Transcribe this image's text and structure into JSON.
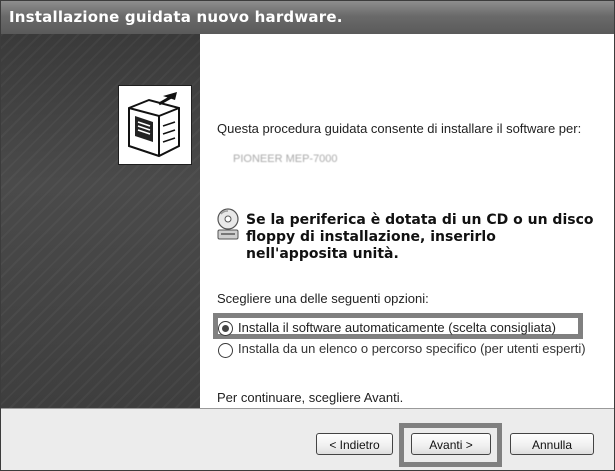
{
  "window": {
    "title": "Installazione guidata nuovo hardware."
  },
  "content": {
    "intro": "Questa procedura guidata consente di installare il software per:",
    "device_name": "PIONEER MEP-7000",
    "cd_notice": "Se la periferica è dotata di un CD o un disco floppy di installazione, inserirlo nell'apposita unità.",
    "choose_label": "Scegliere una delle seguenti opzioni:",
    "options": [
      {
        "label": "Installa il software automaticamente (scelta consigliata)",
        "selected": true
      },
      {
        "label": "Installa da un elenco o percorso specifico (per utenti esperti)",
        "selected": false
      }
    ],
    "continue_text": "Per continuare, scegliere Avanti."
  },
  "buttons": {
    "back": "< Indietro",
    "next": "Avanti >",
    "cancel": "Annulla"
  },
  "icons": [
    "wizard-hardware-icon",
    "cd-icon"
  ],
  "colors": {
    "titlebar": "#6a6a6a",
    "left_panel": "#404040",
    "highlight_box": "#808080"
  }
}
